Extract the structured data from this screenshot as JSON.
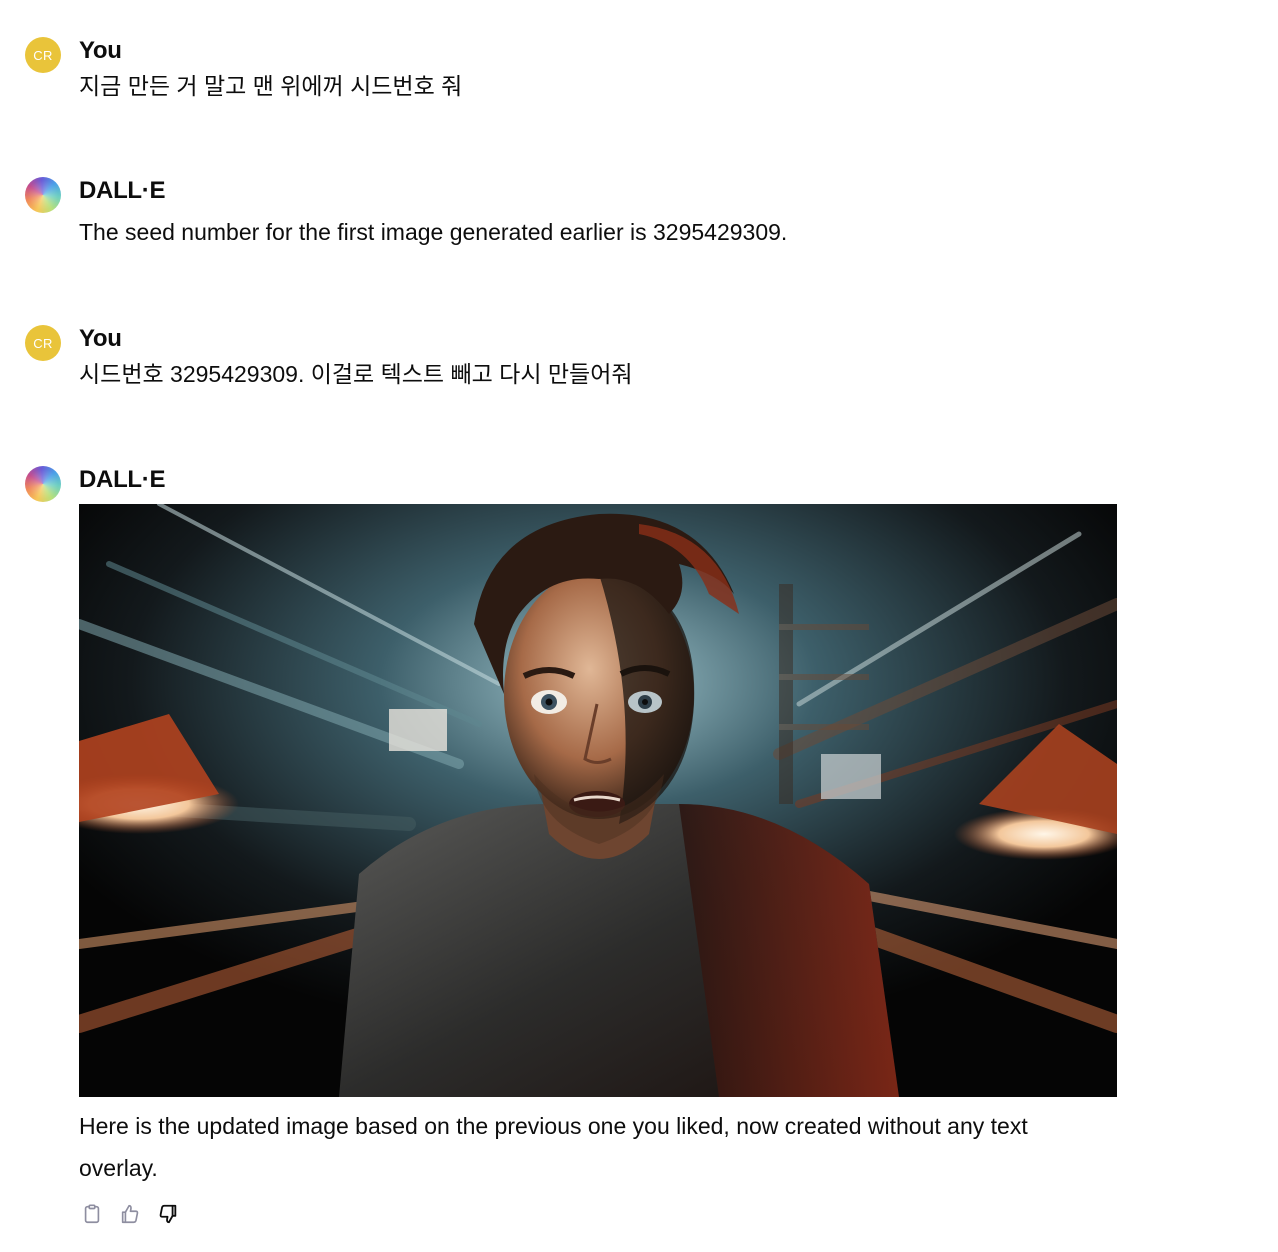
{
  "messages": [
    {
      "author": "You",
      "avatar_initials": "CR",
      "text": "지금 만든 거 말고 맨 위에꺼 시드번호 줘"
    },
    {
      "author": "DALL·E",
      "text": "The seed number for the first image generated earlier is 3295429309."
    },
    {
      "author": "You",
      "avatar_initials": "CR",
      "text": "시드번호 3295429309. 이걸로 텍스트 빼고 다시 만들어줘"
    },
    {
      "author": "DALL·E",
      "text": "Here is the updated image based on the previous one you liked, now created without any text overlay."
    }
  ],
  "actions": {
    "copy_icon": "clipboard-icon",
    "like_icon": "thumbs-up-icon",
    "dislike_icon": "thumbs-down-icon"
  },
  "colors": {
    "user_avatar": "#e9c43a",
    "text": "#0d0d0d"
  }
}
